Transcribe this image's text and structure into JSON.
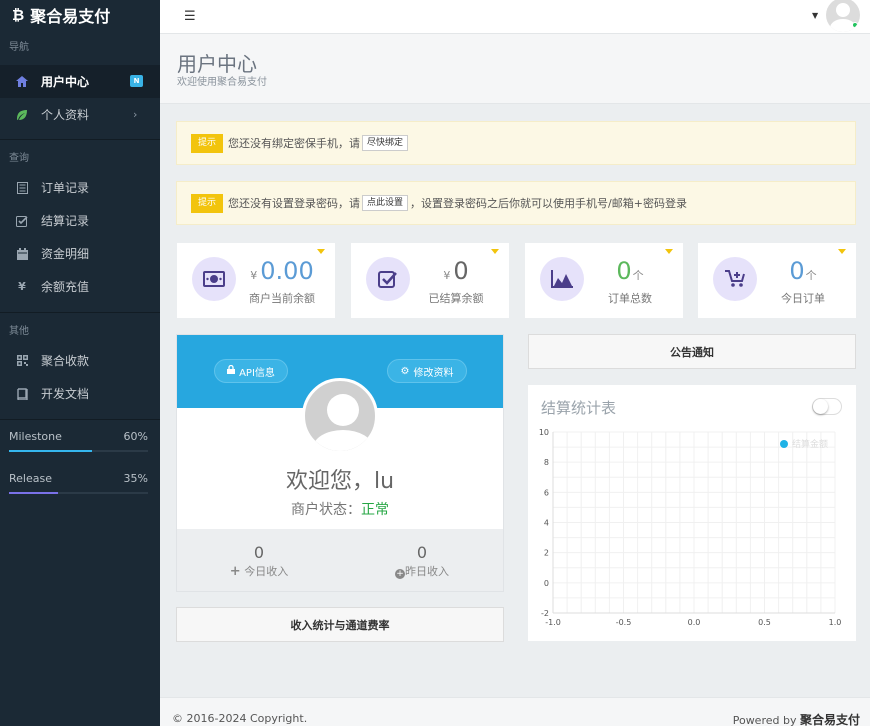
{
  "sidebar": {
    "brand": {
      "logo": "₿",
      "name": "聚合易支付"
    },
    "sections": [
      {
        "title": "导航",
        "items": [
          {
            "icon": "home-icon",
            "label": "用户中心",
            "badge": "N",
            "active": true
          },
          {
            "icon": "leaf-icon",
            "label": "个人资料",
            "arrow": "›"
          }
        ]
      },
      {
        "title": "查询",
        "items": [
          {
            "icon": "list-icon",
            "label": "订单记录"
          },
          {
            "icon": "check-square-icon",
            "label": "结算记录"
          },
          {
            "icon": "calendar-icon",
            "label": "资金明细"
          },
          {
            "icon": "yen-icon",
            "label": "余额充值"
          }
        ]
      },
      {
        "title": "其他",
        "items": [
          {
            "icon": "qrcode-icon",
            "label": "聚合收款"
          },
          {
            "icon": "book-icon",
            "label": "开发文档"
          }
        ]
      }
    ],
    "progress": [
      {
        "label": "Milestone",
        "value": 0.6,
        "percent": "60%",
        "color": "#35b6ee"
      },
      {
        "label": "Release",
        "value": 0.35,
        "percent": "35%",
        "color": "#7a71e8"
      }
    ]
  },
  "topbar": {
    "menu_icon": "☰",
    "caret": "▼"
  },
  "header": {
    "title": "用户中心",
    "subtitle": "欢迎使用聚合易支付"
  },
  "alerts": [
    {
      "tag": "提示",
      "text": "您还没有绑定密保手机，请",
      "button": "尽快绑定",
      "after": ""
    },
    {
      "tag": "提示",
      "text": "您还没有设置登录密码，请",
      "button": "点此设置",
      "after": "，设置登录密码之后你就可以使用手机号/邮箱+密码登录"
    }
  ],
  "stats": [
    {
      "icon": "money-icon",
      "prefix": "¥",
      "value": "0.00",
      "suffix": "",
      "label": "商户当前余额"
    },
    {
      "icon": "check-icon",
      "prefix": "¥",
      "value": "0",
      "suffix": "",
      "label": "已结算余额"
    },
    {
      "icon": "area-chart-icon",
      "prefix": "",
      "value": "0",
      "suffix": "个",
      "label": "订单总数",
      "value_color": "#5cb85c"
    },
    {
      "icon": "cart-plus-icon",
      "prefix": "",
      "value": "0",
      "suffix": "个",
      "label": "今日订单"
    }
  ],
  "profile": {
    "api_label": "API信息",
    "edit_label": "修改资料",
    "welcome": "欢迎您，lu",
    "status_label": "商户状态：",
    "status_value": "正常",
    "today_income": "0",
    "today_label": "今日收入",
    "yesterday_income": "0",
    "yesterday_label": "昨日收入"
  },
  "income_button": "收入统计与通道费率",
  "notice_button": "公告通知",
  "chart_data": {
    "type": "line",
    "title": "结算统计表",
    "series": [
      {
        "name": "结算金额",
        "values": []
      }
    ],
    "xlim": [
      -1.0,
      1.0
    ],
    "ylim": [
      -2,
      10
    ],
    "xticks": [
      "-1.0",
      "-0.5",
      "0.0",
      "0.5",
      "1.0"
    ],
    "yticks": [
      "10",
      "8",
      "6",
      "4",
      "2",
      "0",
      "-2"
    ],
    "grid": true,
    "legend": "top-right",
    "series_color": "#1fb2e6"
  },
  "footer": {
    "copyright": "© 2016-2024 Copyright.",
    "powered_label": "Powered by",
    "powered_name": "聚合易支付"
  }
}
